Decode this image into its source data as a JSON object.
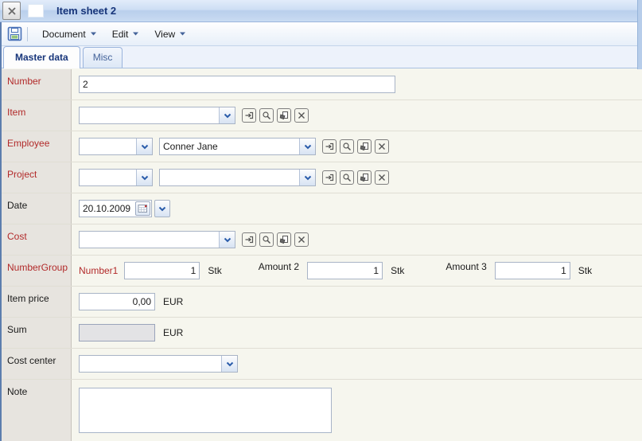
{
  "window": {
    "title": "Item sheet 2"
  },
  "toolbar": {
    "menus": [
      {
        "label": "Document"
      },
      {
        "label": "Edit"
      },
      {
        "label": "View"
      }
    ]
  },
  "tabs": [
    {
      "label": "Master data",
      "active": true
    },
    {
      "label": "Misc",
      "active": false
    }
  ],
  "form": {
    "number": {
      "label": "Number",
      "value": "2"
    },
    "item": {
      "label": "Item",
      "value": ""
    },
    "employee": {
      "label": "Employee",
      "code": "",
      "name": "Conner Jane"
    },
    "project": {
      "label": "Project",
      "code": "",
      "name": ""
    },
    "date": {
      "label": "Date",
      "value": "20.10.2009"
    },
    "cost": {
      "label": "Cost",
      "value": ""
    },
    "number_group": {
      "label": "NumberGroup",
      "fields": [
        {
          "label": "Number1",
          "value": "1",
          "unit": "Stk"
        },
        {
          "label": "Amount 2",
          "value": "1",
          "unit": "Stk"
        },
        {
          "label": "Amount 3",
          "value": "1",
          "unit": "Stk"
        }
      ]
    },
    "item_price": {
      "label": "Item price",
      "value": "0,00",
      "unit": "EUR"
    },
    "sum": {
      "label": "Sum",
      "value": "",
      "unit": "EUR"
    },
    "cost_center": {
      "label": "Cost center",
      "value": ""
    },
    "note": {
      "label": "Note",
      "value": ""
    }
  },
  "colors": {
    "required_label": "#b22a2a",
    "label": "#1a1a1a",
    "title_text": "#17357a",
    "titlebar_blue": "#c6d9f1",
    "chevron_blue": "#2a5caa",
    "label_column_bg": "#e7e4df",
    "content_bg": "#f6f6ee"
  }
}
